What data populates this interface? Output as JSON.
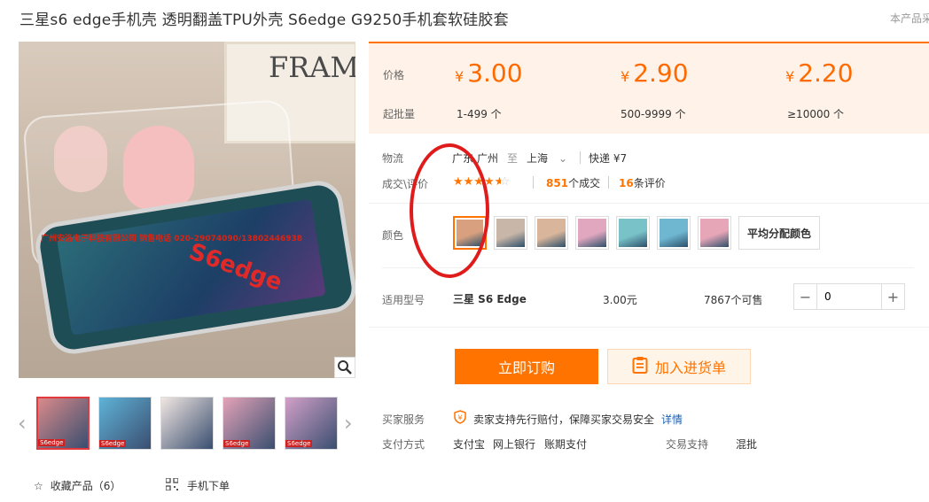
{
  "product": {
    "title": "三星s6 edge手机壳 透明翻盖TPU外壳 S6edge G9250手机套软硅胶套",
    "note": "本产品采"
  },
  "gallery": {
    "main_image_texts": {
      "frame": "FRAME",
      "shop_strip": "广州安洛电子科技有限公司 销售电话 020-29074090/13802446938",
      "model": "S6edge"
    },
    "thumbnails": [
      {
        "label": "S6edge",
        "color": "#d98a8a"
      },
      {
        "label": "S6edge",
        "color": "#5fb3d8"
      },
      {
        "label": "",
        "color": "#f1e7e2"
      },
      {
        "label": "S6edge",
        "color": "#e4a3b8"
      },
      {
        "label": "S6edge",
        "color": "#d2a0c8"
      }
    ],
    "favorite_label": "收藏产品（6）",
    "mobile_order_label": "手机下单"
  },
  "pricing": {
    "price_label": "价格",
    "moq_label": "起批量",
    "currency": "¥",
    "tiers": [
      {
        "price": "3.00",
        "qty": "1-499 个"
      },
      {
        "price": "2.90",
        "qty": "500-9999 个"
      },
      {
        "price": "2.20",
        "qty": "≥10000 个"
      }
    ]
  },
  "logistics": {
    "label": "物流",
    "from_province": "广东",
    "from_city": "广州",
    "to_word": "至",
    "to_city": "上海",
    "express": "快递 ¥7"
  },
  "reviews": {
    "label": "成交\\评价",
    "rating": 4.5,
    "deals_count": "851",
    "deals_suffix": "个成交",
    "reviews_count": "16",
    "reviews_suffix": "条评价"
  },
  "colors": {
    "label": "颜色",
    "swatches": [
      "#d8a07e",
      "#c8b6a8",
      "#d9b69b",
      "#e0a7bf",
      "#79c2c8",
      "#6fb7d1",
      "#e7a6b8"
    ],
    "mix_label": "平均分配颜色"
  },
  "model_row": {
    "label": "适用型号",
    "model": "三星 S6 Edge",
    "price": "3.00元",
    "stock": "7867个可售",
    "quantity": "0"
  },
  "actions": {
    "buy_label": "立即订购",
    "cart_label": "加入进货单"
  },
  "services": {
    "buyer_label": "买家服务",
    "buyer_text": "卖家支持先行赔付，保障买家交易安全",
    "detail_link": "详情",
    "payment_label": "支付方式",
    "payment_methods": [
      "支付宝",
      "网上银行",
      "账期支付"
    ],
    "trade_support_label": "交易支持",
    "trade_support_value": "混批"
  },
  "colors_theme": {
    "accent": "#ff7300",
    "price": "#ff6a00",
    "annotation_circle": "#e01b1b"
  }
}
